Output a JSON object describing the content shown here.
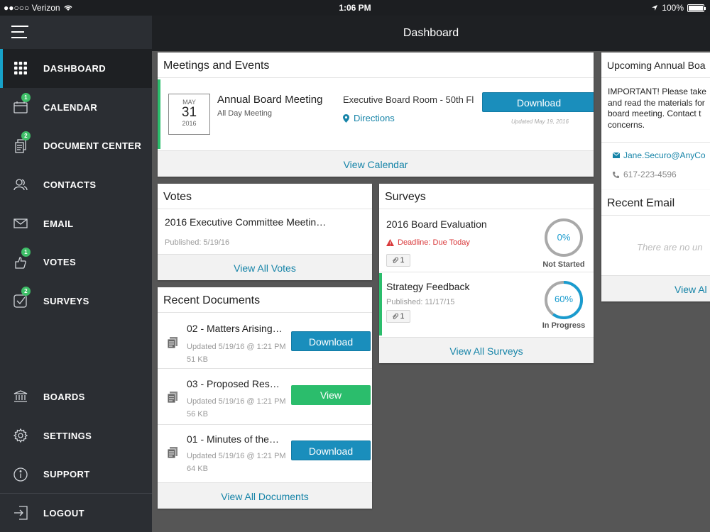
{
  "status_bar": {
    "carrier": "●●○○○ Verizon",
    "time": "1:06 PM",
    "battery": "100%"
  },
  "header": {
    "title": "Dashboard"
  },
  "sidebar": {
    "items": [
      {
        "label": "DASHBOARD",
        "icon": "grid-icon",
        "badge": ""
      },
      {
        "label": "CALENDAR",
        "icon": "calendar-icon",
        "badge": "1"
      },
      {
        "label": "DOCUMENT CENTER",
        "icon": "document-icon",
        "badge": "2"
      },
      {
        "label": "CONTACTS",
        "icon": "people-icon",
        "badge": ""
      },
      {
        "label": "EMAIL",
        "icon": "envelope-icon",
        "badge": ""
      },
      {
        "label": "VOTES",
        "icon": "vote-icon",
        "badge": "1"
      },
      {
        "label": "SURVEYS",
        "icon": "survey-icon",
        "badge": "2"
      }
    ],
    "bottom_items": [
      {
        "label": "BOARDS",
        "icon": "bank-icon"
      },
      {
        "label": "SETTINGS",
        "icon": "gear-icon"
      },
      {
        "label": "SUPPORT",
        "icon": "info-icon"
      },
      {
        "label": "LOGOUT",
        "icon": "logout-icon"
      }
    ]
  },
  "meetings": {
    "title": "Meetings and Events",
    "event": {
      "month": "MAY",
      "day": "31",
      "year": "2016",
      "name": "Annual Board Meeting",
      "time": "All Day Meeting",
      "location": "Executive Board Room - 50th Fl",
      "directions": "Directions",
      "button": "Download",
      "updated": "Updated May 19, 2016"
    },
    "footer": "View Calendar"
  },
  "votes": {
    "title": "Votes",
    "item": {
      "name": "2016 Executive Committee Meetin…",
      "published": "Published: 5/19/16"
    },
    "footer": "View All Votes"
  },
  "documents": {
    "title": "Recent Documents",
    "items": [
      {
        "name": "02 - Matters Arising…",
        "updated": "Updated 5/19/16 @ 1:21 PM",
        "size": "51 KB",
        "button": "Download",
        "kind": "blue"
      },
      {
        "name": "03 - Proposed Res…",
        "updated": "Updated 5/19/16 @ 1:21 PM",
        "size": "56 KB",
        "button": "View",
        "kind": "green"
      },
      {
        "name": "01 - Minutes of the…",
        "updated": "Updated 5/19/16 @ 1:21 PM",
        "size": "64 KB",
        "button": "Download",
        "kind": "blue"
      }
    ],
    "footer": "View All Documents"
  },
  "surveys": {
    "title": "Surveys",
    "items": [
      {
        "name": "2016 Board Evaluation",
        "meta": "Deadline: Due Today",
        "attachments": "1",
        "progress": 0,
        "progress_label": "0%",
        "status": "Not Started"
      },
      {
        "name": "Strategy Feedback",
        "meta": "Published: 11/17/15",
        "attachments": "1",
        "progress": 60,
        "progress_label": "60%",
        "status": "In Progress"
      }
    ],
    "footer": "View All Surveys"
  },
  "announcement": {
    "title": "Upcoming Annual Boa",
    "lines": [
      "IMPORTANT!  Please take",
      "and read the materials for",
      "board meeting.  Contact t",
      "concerns."
    ],
    "email": "Jane.Securo@AnyCo",
    "phone": "617-223-4596"
  },
  "recent_email": {
    "title": "Recent Email",
    "empty": "There are no un",
    "footer": "View Al"
  },
  "colors": {
    "accent": "#1a8ebc",
    "green": "#2bbd6c",
    "alert": "#d9383a"
  }
}
